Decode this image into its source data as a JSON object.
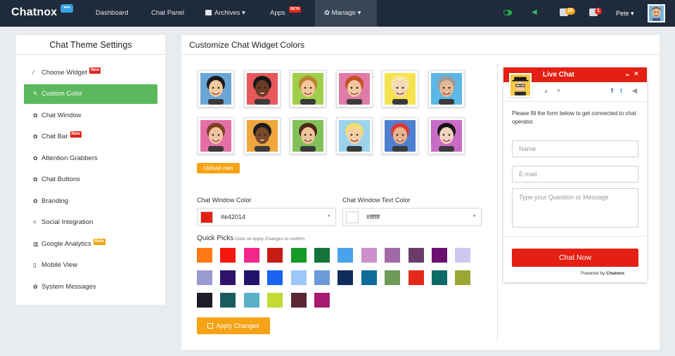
{
  "nav": {
    "brand": "Chatnox",
    "brand_bubble": "•••",
    "items": [
      "Dashboard",
      "Chat Panel",
      "Archives",
      "Apps",
      "Manage"
    ],
    "archives_icon": "archive-icon",
    "manage_icon": "gears-icon",
    "apps_badge": "BETA",
    "messages_count": "28",
    "alerts_count": "1",
    "user": "Pete"
  },
  "sidebar": {
    "title": "Chat Theme Settings",
    "items": [
      {
        "label": "Choose Widget",
        "icon": "magic-wand-icon",
        "badge": "New"
      },
      {
        "label": "Custom Color",
        "icon": "edit-icon",
        "active": true
      },
      {
        "label": "Chat Window",
        "icon": "gears-icon"
      },
      {
        "label": "Chat Bar",
        "icon": "gears-icon",
        "badge": "New"
      },
      {
        "label": "Attention Grabbers",
        "icon": "gears-icon"
      },
      {
        "label": "Chat Buttons",
        "icon": "gears-icon"
      },
      {
        "label": "Branding",
        "icon": "gears-icon"
      },
      {
        "label": "Social Integration",
        "icon": "share-icon"
      },
      {
        "label": "Google Analytics",
        "icon": "bar-chart-icon",
        "badge": "Beta"
      },
      {
        "label": "Mobile View",
        "icon": "mobile-icon"
      },
      {
        "label": "System Messages",
        "icon": "gears-icon"
      }
    ]
  },
  "main": {
    "title": "Customize Chat Widget Colors",
    "avatars": [
      {
        "bg": "#6aa5d6",
        "skin": "#f2c99c",
        "hair": "#1b1b1b"
      },
      {
        "bg": "#e8585a",
        "skin": "#6b3a22",
        "hair": "#161616"
      },
      {
        "bg": "#9fcf4a",
        "skin": "#f3c79a",
        "hair": "#b9852f"
      },
      {
        "bg": "#e07aa6",
        "skin": "#f3c6a2",
        "hair": "#c74f21"
      },
      {
        "bg": "#f4e34f",
        "skin": "#f6d7b8",
        "hair": "#f6e6a8"
      },
      {
        "bg": "#5ab7e6",
        "skin": "#e6b895",
        "hair": "#9a9a9a"
      },
      {
        "bg": "#e46ea8",
        "skin": "#f1c4a0",
        "hair": "#7a4222"
      },
      {
        "bg": "#f0a63d",
        "skin": "#7a4a2a",
        "hair": "#1b1b1b"
      },
      {
        "bg": "#82c15a",
        "skin": "#efc29a",
        "hair": "#4a2b18"
      },
      {
        "bg": "#9bd3ef",
        "skin": "#f6d0a5",
        "hair": "#f2de6e"
      },
      {
        "bg": "#4f7fd0",
        "skin": "#e8b48f",
        "hair": "#d63939"
      },
      {
        "bg": "#c96bc7",
        "skin": "#f3d3c0",
        "hair": "#141414"
      }
    ],
    "upload_label": "Upload own",
    "window_color_label": "Chat Window Color",
    "window_color_value": "#e42014",
    "window_color_hex": "#e42014",
    "text_color_label": "Chat Window Text Color",
    "text_color_value": "#ffffff",
    "text_color_hex": "#ffffff",
    "quick_picks_label": "Quick Picks",
    "quick_picks_hint": "Click on Apply Changes to confirm",
    "quick_picks": [
      "#ff7a12",
      "#f5170f",
      "#f0268a",
      "#c51d14",
      "#169a28",
      "#14733a",
      "#4aa2ea",
      "#cc90cc",
      "#a06aa6",
      "#6b3b6a",
      "#6b1070",
      "#cfc6f0",
      "#9a9ad0",
      "#2f136b",
      "#22146e",
      "#1a62f0",
      "#9cc8f8",
      "#6a9ad8",
      "#102c5a",
      "#0d6c9a",
      "#6e9a5a",
      "#e32a1a",
      "#0e6a66",
      "#9aa833",
      "#1e1c27",
      "#1a5c62",
      "#5ab0c8",
      "#c2da32",
      "#5a2632",
      "#a81a72"
    ],
    "apply_label": "Apply Changes"
  },
  "chat_preview": {
    "title": "Live Chat",
    "message": "Please fill the form below to get connected to chat operator.",
    "name_placeholder": "Name",
    "email_placeholder": "E-mail",
    "question_placeholder": "Type your Question or Message",
    "chat_now": "Chat Now",
    "powered_prefix": "Powered by",
    "powered_brand": "Chatnox"
  }
}
